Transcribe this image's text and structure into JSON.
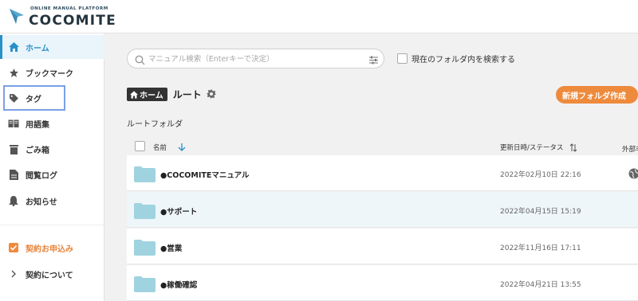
{
  "header": {
    "tagline": "ONLINE MANUAL PLATFORM",
    "brand": "COCOMITE"
  },
  "sidebar": {
    "items": [
      {
        "label": "ホーム",
        "icon": "home-icon",
        "active": true
      },
      {
        "label": "ブックマーク",
        "icon": "star-icon"
      },
      {
        "label": "タグ",
        "icon": "tag-icon"
      },
      {
        "label": "用語集",
        "icon": "book-icon"
      },
      {
        "label": "ごみ箱",
        "icon": "trash-icon"
      },
      {
        "label": "閲覧ログ",
        "icon": "document-icon"
      },
      {
        "label": "お知らせ",
        "icon": "bell-icon"
      }
    ],
    "footer": [
      {
        "label": "契約お申込み",
        "icon": "checkbox-icon"
      },
      {
        "label": "契約について",
        "icon": "chevron-right-icon"
      }
    ]
  },
  "search": {
    "placeholder": "マニュアル検索（Enterキーで決定）",
    "value": "",
    "current_folder_label": "現在のフォルダ内を検索する"
  },
  "breadcrumb": {
    "home": "ホーム",
    "current": "ルート"
  },
  "actions": {
    "new_folder": "新規フォルダ作成"
  },
  "section": {
    "title": "ルートフォルダ"
  },
  "table": {
    "col_name": "名前",
    "col_date": "更新日時/ステータス",
    "col_ext": "外部非",
    "rows": [
      {
        "name": "●COCOMITEマニュアル",
        "date": "2022年02月10日 22:16",
        "external": true
      },
      {
        "name": "●サポート",
        "date": "2022年04月15日 15:19",
        "external": false
      },
      {
        "name": "●営業",
        "date": "2022年11月16日 17:11",
        "external": false
      },
      {
        "name": "●稼働確認",
        "date": "2022年04月21日 13:55",
        "external": false
      }
    ]
  },
  "colors": {
    "accent": "#2a90c8",
    "orange": "#ee8a3c",
    "folder": "#9fd3df"
  }
}
